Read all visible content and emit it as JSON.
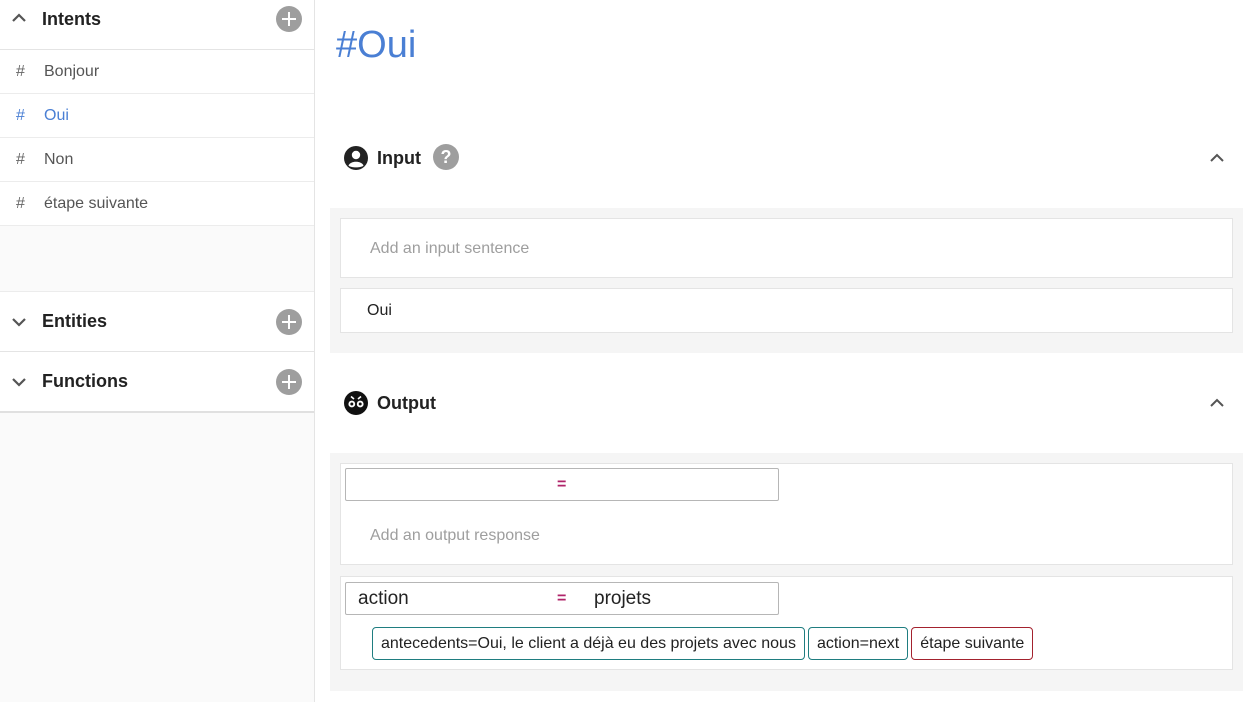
{
  "sidebar": {
    "intents": {
      "title": "Intents",
      "items": [
        {
          "hash": "#",
          "label": "Bonjour"
        },
        {
          "hash": "#",
          "label": "Oui",
          "active": true
        },
        {
          "hash": "#",
          "label": "Non"
        },
        {
          "hash": "#",
          "label": "étape suivante"
        }
      ]
    },
    "entities": {
      "title": "Entities"
    },
    "functions": {
      "title": "Functions"
    }
  },
  "main": {
    "title": "#Oui",
    "input": {
      "title": "Input",
      "help": "?",
      "placeholder": "Add an input sentence",
      "sentences": [
        "Oui"
      ]
    },
    "output": {
      "title": "Output",
      "new_assignment": {
        "eq": "="
      },
      "placeholder": "Add an output response",
      "response": {
        "lhs": "action",
        "eq": "=",
        "rhs": "projets",
        "chips": [
          {
            "text": "antecedents=Oui, le client a déjà eu des projets avec nous",
            "color": "#1f7d80"
          },
          {
            "text": "action=next",
            "color": "#1f7d80"
          },
          {
            "text": "étape suivante",
            "color": "#a3222e"
          }
        ]
      }
    }
  },
  "colors": {
    "accent": "#4a7fd4",
    "equals": "#b0246a"
  }
}
